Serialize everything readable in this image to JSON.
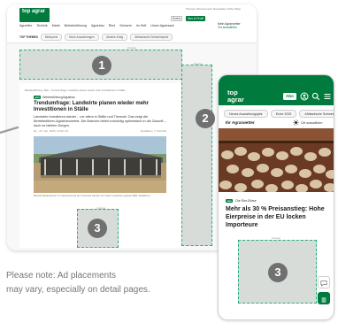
{
  "desktop": {
    "logo": "top agrar",
    "top_links": "Themen   Abonnement   Newsletter   Hilfe   Shop",
    "search_label": "Suche",
    "subscribe_label": "Abo & Profil",
    "nav": [
      "Agrarflex",
      "Technik",
      "Markt",
      "Betriebsführung",
      "Agrarbau",
      "Rind",
      "Schwein",
      "Im Heft",
      "Unser Agrarsack"
    ],
    "account": {
      "line1": "Mein Agrarwetter",
      "line2": "Ort auswählen"
    },
    "topics_label": "TOP THEMEN",
    "topics": [
      "Milchpreis",
      "Neue Auszahlungen",
      "Ukraine-Krieg",
      "Afrikanische Schweinepest"
    ],
    "ad_label": "Anzeige",
    "breadcrumb": "Betriebsführung › Bau › Trendumfrage: Landwirte planen wieder mehr Investitionen in Ställe",
    "badge_text": "Betriebsführung/Agrarbau",
    "plus_label": "plus",
    "article_title": "Trendumfrage: Landwirte planen wieder mehr Investitionen in Ställe",
    "article_lead": "Landwirte investieren wieder – vor allem in Ställe und Tierwohl. Das zeigt die Betriebsführer-Agrarbarometer. Die Branche bleibt vorsichtig optimistisch in die Zukunft – doch es bleiben Sorgen.",
    "article_date": "Do., 23. Jan. 2025, 12:00 Uhr",
    "article_author": "Redaktion, T. Schmidt",
    "photo_caption": "Bauliche Maßnahmen zur Verbesserung des Tierwohls werden von vielen Landwirten geplant (Bild: Redaktion)"
  },
  "ads": {
    "one": "1",
    "two": "2",
    "three": "3"
  },
  "note": {
    "line1": "Please note: Ad placements",
    "line2": "may vary, especially on detail pages."
  },
  "mobile": {
    "logo_line1": "top",
    "logo_line2": "agrar",
    "abo_label": "Abo",
    "chips": [
      "Neues Auszahlungsjahr",
      "Ernte 2025",
      "Afrikanische Schwein"
    ],
    "weather_label": "Ihr Agrarwetter",
    "weather_select": "Ort auswählen",
    "plus_label": "plus",
    "badge_text": "Die Eier-Börse",
    "article_title": "Mehr als 30 % Preisanstieg: Hohe Eierpreise in der EU locken Importeure",
    "ad_label": "Anzeige"
  },
  "colors": {
    "brand_green": "#007a3d",
    "ad_gray": "#d8dcd9",
    "ad_dash": "#21b27a"
  }
}
